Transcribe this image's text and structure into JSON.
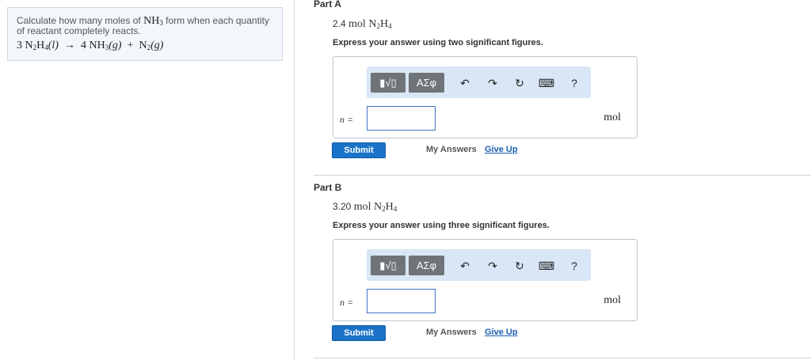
{
  "problem": {
    "text_pre": "Calculate how many moles of",
    "text_formula": "NH",
    "text_formula_sub": "3",
    "text_post": "form when each quantity of reactant completely reacts.",
    "equation": {
      "c1": "3",
      "r1": "N",
      "r1s1": "2",
      "r1b": "H",
      "r1s2": "4",
      "r1state": "(l)",
      "arrow": "→",
      "c2": "4",
      "p1": "NH",
      "p1s": "3",
      "p1state": "(g)",
      "plus": "+",
      "p2": "N",
      "p2s": "2",
      "p2state": "(g)"
    }
  },
  "parts": [
    {
      "title": "Part A",
      "amount": "2.4",
      "unit_mol": "mol",
      "species": "N",
      "s1": "2",
      "species_b": "H",
      "s2": "4",
      "instruction": "Express your answer using two significant figures.",
      "toolbar": {
        "templates": "▮√▯",
        "symbols": "ΑΣφ",
        "undo": "↶",
        "redo": "↷",
        "reset": "↻",
        "keyboard": "⌨",
        "help": "?"
      },
      "var_label": "n =",
      "input_value": "",
      "answer_unit": "mol",
      "submit": "Submit",
      "my_answers": "My Answers",
      "give_up": "Give Up"
    },
    {
      "title": "Part B",
      "amount": "3.20",
      "unit_mol": "mol",
      "species": "N",
      "s1": "2",
      "species_b": "H",
      "s2": "4",
      "instruction": "Express your answer using three significant figures.",
      "toolbar": {
        "templates": "▮√▯",
        "symbols": "ΑΣφ",
        "undo": "↶",
        "redo": "↷",
        "reset": "↻",
        "keyboard": "⌨",
        "help": "?"
      },
      "var_label": "n =",
      "input_value": "",
      "answer_unit": "mol",
      "submit": "Submit",
      "my_answers": "My Answers",
      "give_up": "Give Up"
    }
  ]
}
